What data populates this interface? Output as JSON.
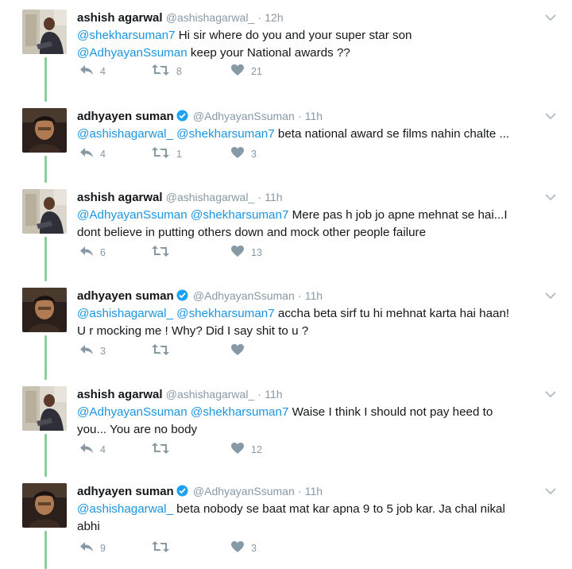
{
  "colors": {
    "mention": "#1b95e0",
    "thread_line": "#8ccf99",
    "meta": "#8899a6",
    "verified": "#1da1f2"
  },
  "tweets": [
    {
      "name": "ashish agarwal",
      "handle": "@ashishagarwal_",
      "sep": "·",
      "time": "12h",
      "verified": false,
      "avatar": "avatar-ashish",
      "lines": [
        {
          "m1": "@shekharsuman7",
          "m2": "",
          "rest": " Hi sir where do you and your super star son"
        },
        {
          "m1": "@AdhyayanSsuman",
          "m2": "",
          "rest": " keep your National awards  ??"
        }
      ],
      "reply": "4",
      "retweet": "8",
      "like": "21"
    },
    {
      "name": "adhyayen suman",
      "handle": "@AdhyayanSsuman",
      "sep": "·",
      "time": "11h",
      "verified": true,
      "avatar": "avatar-adhyayan",
      "lines": [
        {
          "m1": "@ashishagarwal_",
          "m2": " @shekharsuman7",
          "rest": " beta national award se films nahin chalte ..."
        }
      ],
      "reply": "4",
      "retweet": "1",
      "like": "3"
    },
    {
      "name": "ashish agarwal",
      "handle": "@ashishagarwal_",
      "sep": "·",
      "time": "11h",
      "verified": false,
      "avatar": "avatar-ashish",
      "lines": [
        {
          "m1": "@AdhyayanSsuman",
          "m2": " @shekharsuman7",
          "rest": " Mere pas h job jo apne mehnat se  hai...I"
        },
        {
          "m1": "",
          "m2": "",
          "rest": "dont believe in putting others down and mock other people failure"
        }
      ],
      "reply": "6",
      "retweet": "",
      "like": "13"
    },
    {
      "name": "adhyayen suman",
      "handle": "@AdhyayanSsuman",
      "sep": "·",
      "time": "11h",
      "verified": true,
      "avatar": "avatar-adhyayan",
      "lines": [
        {
          "m1": "@ashishagarwal_",
          "m2": " @shekharsuman7",
          "rest": " accha beta sirf tu hi mehnat karta hai haan!"
        },
        {
          "m1": "",
          "m2": "",
          "rest": "U r mocking me ! Why? Did I say shit to u ?"
        }
      ],
      "reply": "3",
      "retweet": "",
      "like": ""
    },
    {
      "name": "ashish agarwal",
      "handle": "@ashishagarwal_",
      "sep": "·",
      "time": "11h",
      "verified": false,
      "avatar": "avatar-ashish",
      "lines": [
        {
          "m1": "@AdhyayanSsuman",
          "m2": " @shekharsuman7",
          "rest": " Waise I think I should not pay heed to"
        },
        {
          "m1": "",
          "m2": "",
          "rest": "you... You are no body"
        }
      ],
      "reply": "4",
      "retweet": "",
      "like": "12"
    },
    {
      "name": "adhyayen suman",
      "handle": "@AdhyayanSsuman",
      "sep": "·",
      "time": "11h",
      "verified": true,
      "avatar": "avatar-adhyayan",
      "lines": [
        {
          "m1": "@ashishagarwal_",
          "m2": "",
          "rest": " beta nobody se baat mat kar apna 9 to 5 job kar. Ja chal nikal"
        },
        {
          "m1": "",
          "m2": "",
          "rest": "abhi"
        }
      ],
      "reply": "9",
      "retweet": "",
      "like": "3"
    }
  ]
}
